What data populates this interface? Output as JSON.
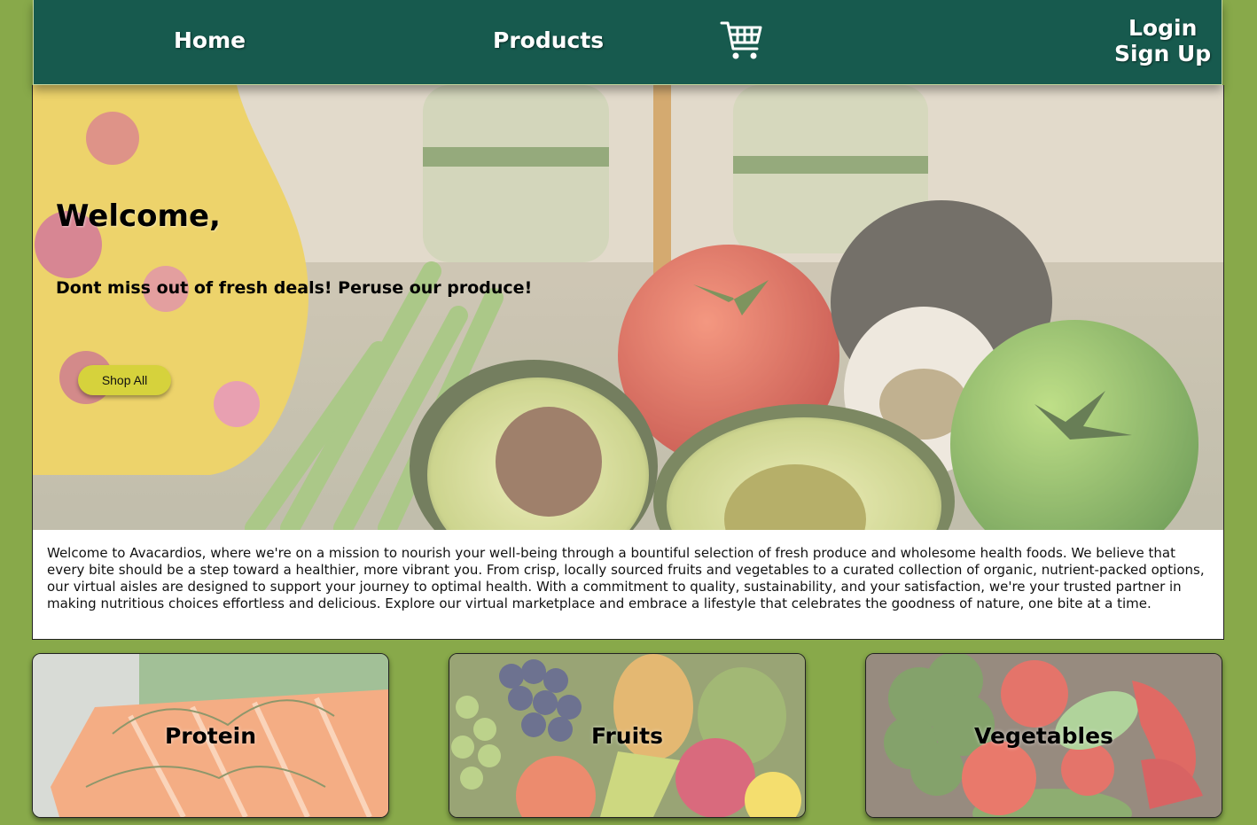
{
  "nav": {
    "home": "Home",
    "products": "Products",
    "cart_icon": "shopping-cart-icon",
    "login": "Login",
    "signup": "Sign Up"
  },
  "hero": {
    "title": "Welcome,",
    "subtitle": "Dont miss out of fresh deals! Peruse our produce!",
    "button": "Shop All"
  },
  "about": {
    "text": "Welcome to Avacardios, where we're on a mission to nourish your well-being through a bountiful selection of fresh produce and wholesome health foods. We believe that every bite should be a step toward a healthier, more vibrant you. From crisp, locally sourced fruits and vegetables to a curated collection of organic, nutrient-packed options, our virtual aisles are designed to support your journey to optimal health. With a commitment to quality, sustainability, and your satisfaction, we're your trusted partner in making nutritious choices effortless and delicious. Explore our virtual marketplace and embrace a lifestyle that celebrates the goodness of nature, one bite at a time."
  },
  "categories": [
    {
      "label": "Protein"
    },
    {
      "label": "Fruits"
    },
    {
      "label": "Vegetables"
    }
  ],
  "colors": {
    "page_background": "#88a94a",
    "nav_background": "#175a4e",
    "button": "#d6d23c"
  }
}
